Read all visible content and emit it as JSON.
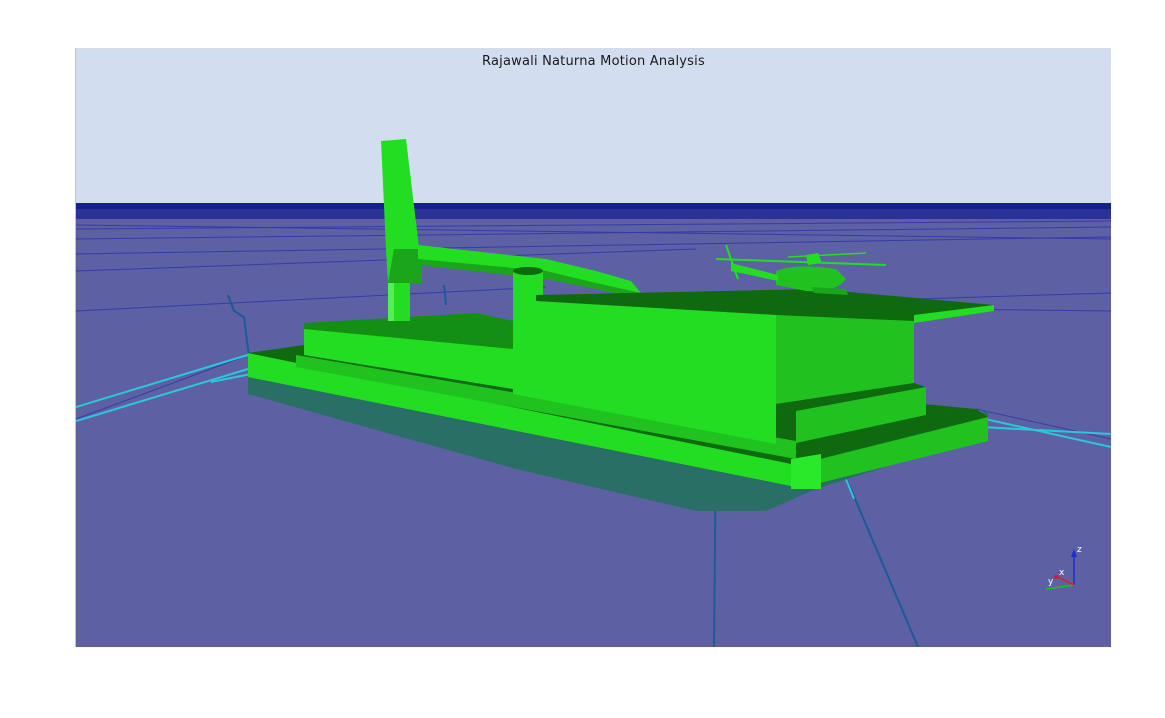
{
  "viewer": {
    "title": "Rajawali Naturna Motion Analysis"
  },
  "axes": {
    "z_label": "z",
    "x_label": "x",
    "y_label": "y",
    "z_color": "#1f2ad8",
    "x_color": "#d62020",
    "y_color": "#20c020"
  },
  "colors": {
    "sky": "#d3ddf0",
    "sea": "#5e60a4",
    "horizon": "#0e1a8c",
    "structure_light": "#22dd22",
    "structure_mid": "#1fbf1f",
    "structure_dark": "#0e6e0e",
    "hull_teal": "#2a6f66",
    "mooring_line": "#2ac8d8",
    "grid_line": "#1e2aa8"
  }
}
